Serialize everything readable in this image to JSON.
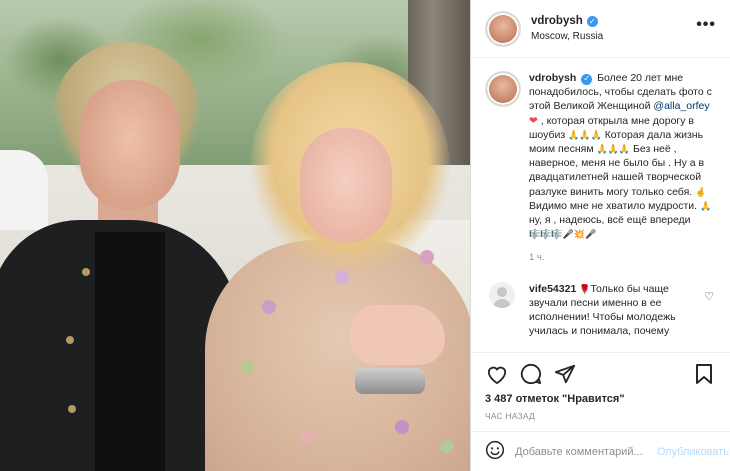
{
  "header": {
    "username": "vdrobysh",
    "location": "Moscow, Russia",
    "more_glyph": "•••"
  },
  "caption": {
    "username": "vdrobysh",
    "text_1": "Более 20 лет мне понадобилось, чтобы сделать фото с этой Великой Женщиной",
    "mention": "@alla_orfey",
    "text_2": ", которая открыла мне дорогу в шоубиз",
    "text_3": "Которая дала жизнь моим песням",
    "text_4": "Без неё , наверное, меня не было бы . Ну а в двадцатилетней нашей творческой разлуке винить могу только себя.",
    "text_5": "Видимо мне не хватило мудрости.",
    "text_6": "ну, я , надеюсь, всё ещё впереди",
    "time": "1 ч."
  },
  "comment": {
    "username": "vife54321",
    "text": "Только бы чаще звучали песни именно в ее исполнении! Чтобы молодежь училась и понимала, почему"
  },
  "actions": {
    "likes": "3 487 отметок \"Нравится\"",
    "time": "ЧАС НАЗАД"
  },
  "add_comment": {
    "placeholder": "Добавьте комментарий...",
    "post_label": "Опубликовать"
  },
  "colors": {
    "verified": "#3897f0",
    "mention": "#00376b",
    "muted": "#8e8e8e",
    "post_disabled": "#b3dbff"
  }
}
